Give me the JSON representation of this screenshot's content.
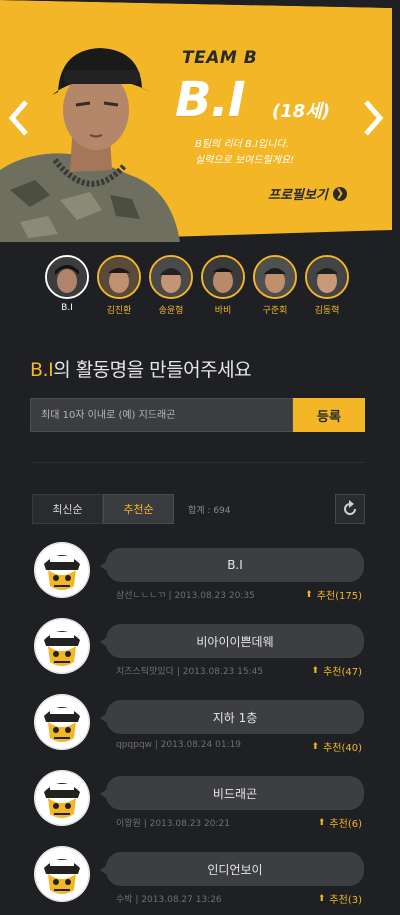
{
  "hero": {
    "team": "TEAM B",
    "name": "B.I",
    "age": "(18세)",
    "tagline": [
      "B팀의 리더 B.I입니다.",
      "실력으로 보여드릴게요!"
    ],
    "profile_link": "프로필보기"
  },
  "members": [
    {
      "label": "B.I",
      "active": true
    },
    {
      "label": "김진환",
      "active": false
    },
    {
      "label": "송윤형",
      "active": false
    },
    {
      "label": "바비",
      "active": false
    },
    {
      "label": "구준회",
      "active": false
    },
    {
      "label": "김동혁",
      "active": false
    }
  ],
  "section": {
    "title_highlight": "B.I",
    "title_rest": "의 활동명을 만들어주세요",
    "input_placeholder": "최대 10자 이내로 (예) 지드래곤",
    "submit_label": "등록"
  },
  "sort": {
    "latest": "최신순",
    "recommended": "추천순",
    "total": "합계 : 694"
  },
  "entries": [
    {
      "name": "B.I",
      "author": "삼선ㄴㄴㄴㄲ",
      "date": "2013.08.23 20:35",
      "vote": "추천(175)"
    },
    {
      "name": "비아이이쁜데웨",
      "author": "치즈스틱맛있다",
      "date": "2013.08.23 15:45",
      "vote": "추천(47)"
    },
    {
      "name": "지하 1층",
      "author": "qpqpqw",
      "date": "2013.08.24 01:19",
      "vote": "추천(40)"
    },
    {
      "name": "비드래곤",
      "author": "이왕원",
      "date": "2013.08.23 20:21",
      "vote": "추천(6)"
    },
    {
      "name": "인디언보이",
      "author": "수박",
      "date": "2013.08.27 13:26",
      "vote": "추천(3)"
    }
  ],
  "colors": {
    "accent": "#f2b626",
    "background": "#1f2023"
  }
}
